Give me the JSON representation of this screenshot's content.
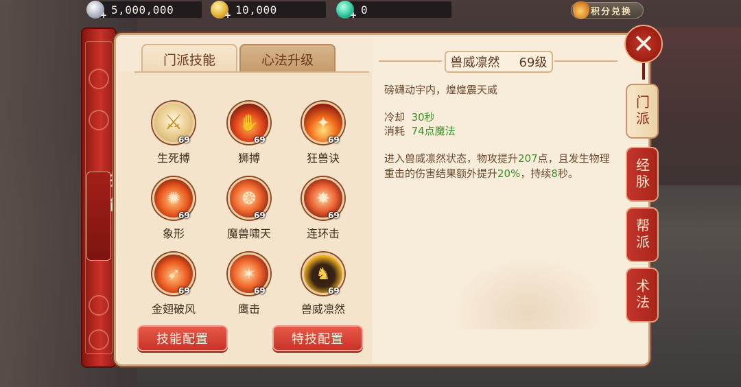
{
  "currencies": [
    {
      "icon": "silver-coin-icon",
      "value": "5,000,000"
    },
    {
      "icon": "gold-coin-icon",
      "value": "10,000"
    },
    {
      "icon": "jade-icon",
      "value": "0"
    }
  ],
  "points_exchange_label": "积分兑换",
  "scroll_label": "技能",
  "tabs": [
    {
      "label": "门派技能",
      "active": true
    },
    {
      "label": "心法升级",
      "active": false
    }
  ],
  "skills": [
    {
      "name": "生死搏",
      "level": "69",
      "icon": "blade-icon"
    },
    {
      "name": "狮搏",
      "level": "69",
      "icon": "lion-claw-icon"
    },
    {
      "name": "狂兽诀",
      "level": "69",
      "icon": "beast-flame-icon"
    },
    {
      "name": "象形",
      "level": "69",
      "icon": "elephant-stomp-icon"
    },
    {
      "name": "魔兽啸天",
      "level": "69",
      "icon": "beast-roar-icon"
    },
    {
      "name": "连环击",
      "level": "69",
      "icon": "combo-strike-icon"
    },
    {
      "name": "金翅破风",
      "level": "69",
      "icon": "golden-wing-icon"
    },
    {
      "name": "鹰击",
      "level": "69",
      "icon": "eagle-strike-icon"
    },
    {
      "name": "兽威凛然",
      "level": "69",
      "icon": "beast-majesty-icon",
      "selected": true
    }
  ],
  "buttons": {
    "skill_config": "技能配置",
    "special_config": "特技配置"
  },
  "detail": {
    "skill_name": "兽威凛然",
    "skill_level": "69级",
    "flavor": "磅礴动宇内，煌煌震天威",
    "cooldown_label": "冷却",
    "cooldown_value": "30秒",
    "cost_label": "消耗",
    "cost_value": "74点魔法",
    "effect": {
      "p1": "进入兽威凛然状态，物攻提升",
      "v1": "207",
      "p2": "点，且发生物理重击的伤害结果额外提升",
      "v2": "20%",
      "p3": "，持续",
      "v3": "8",
      "p4": "秒。"
    }
  },
  "side_tabs": [
    {
      "label": "门派",
      "active": true
    },
    {
      "label": "经脉",
      "active": false
    },
    {
      "label": "帮派",
      "active": false
    },
    {
      "label": "术法",
      "active": false
    }
  ],
  "close_label": "✕"
}
